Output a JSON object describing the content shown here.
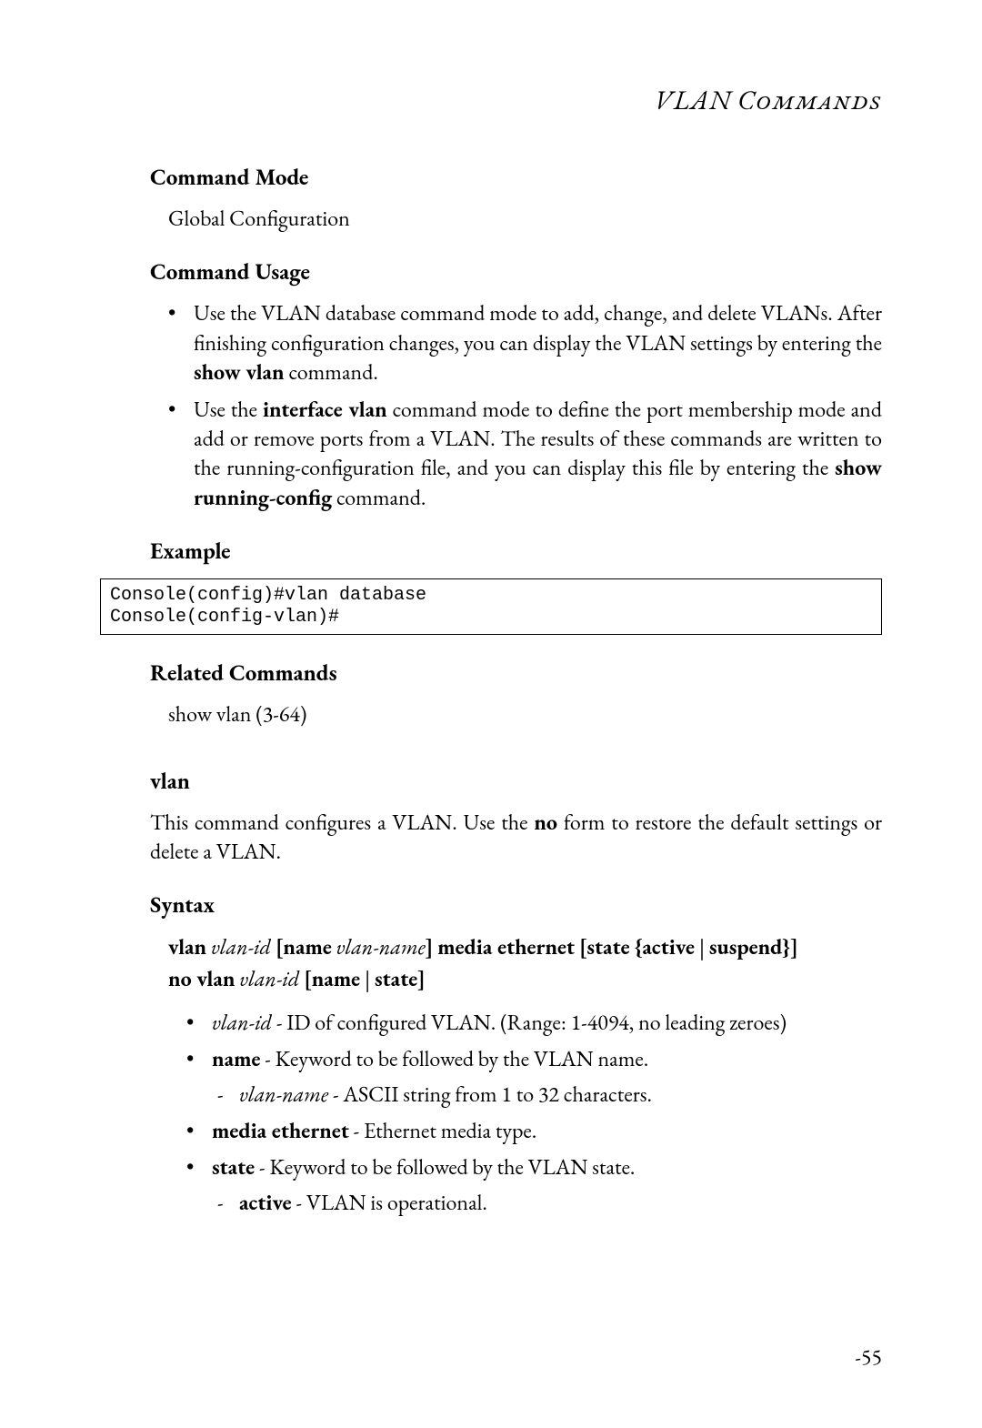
{
  "header_title": "VLAN Commands",
  "sections": {
    "command_mode": {
      "heading": "Command Mode",
      "text": "Global Configuration"
    },
    "command_usage": {
      "heading": "Command Usage",
      "bullets": [
        {
          "pre": "Use the VLAN database command mode to add, change, and delete VLANs. After finishing configuration changes, you can display the VLAN settings by entering the ",
          "bold": "show vlan",
          "post": " command."
        },
        {
          "pre": "Use the ",
          "bold": "interface vlan",
          "mid": " command mode to define the port membership mode and add or remove ports from a VLAN. The results of these commands are written to the running-configuration file, and you can display this file by entering the ",
          "bold2": "show running-config",
          "post": " command."
        }
      ]
    },
    "example": {
      "heading": "Example",
      "code": "Console(config)#vlan database\nConsole(config-vlan)#"
    },
    "related": {
      "heading": "Related Commands",
      "text": "show vlan (3-64)"
    },
    "vlan": {
      "heading": "vlan",
      "text_pre": "This command configures a VLAN. Use the ",
      "text_bold": "no",
      "text_post": " form to restore the default settings or delete a VLAN."
    },
    "syntax": {
      "heading": "Syntax",
      "line1": {
        "p1": "vlan",
        "p2": "vlan-id",
        "p3": "[",
        "p4": "name",
        "p5": "vlan-name",
        "p6": "]",
        "p7": "media ethernet",
        "p8": "[",
        "p9": "state",
        "p10": "{",
        "p11": "active",
        "p12": " | ",
        "p13": "suspend",
        "p14": "}]"
      },
      "line2": {
        "p1": "no vlan",
        "p2": "vlan-id",
        "p3": "[",
        "p4": "name",
        "p5": " | ",
        "p6": "state",
        "p7": "]"
      },
      "bullets": [
        {
          "italic": "vlan-id",
          "rest": " - ID of configured VLAN. (Range: 1-4094, no leading zeroes)"
        },
        {
          "bold": "name",
          "rest": " - Keyword to be followed by the VLAN name.",
          "sub": [
            {
              "italic": "vlan-name",
              "rest": " - ASCII string from 1 to 32 characters."
            }
          ]
        },
        {
          "bold": "media ethernet",
          "rest": " - Ethernet media type."
        },
        {
          "bold": "state",
          "rest": " - Keyword to be followed by the VLAN state.",
          "sub": [
            {
              "bold": "active",
              "rest": " - VLAN is operational."
            }
          ]
        }
      ]
    }
  },
  "page_number": "-55"
}
